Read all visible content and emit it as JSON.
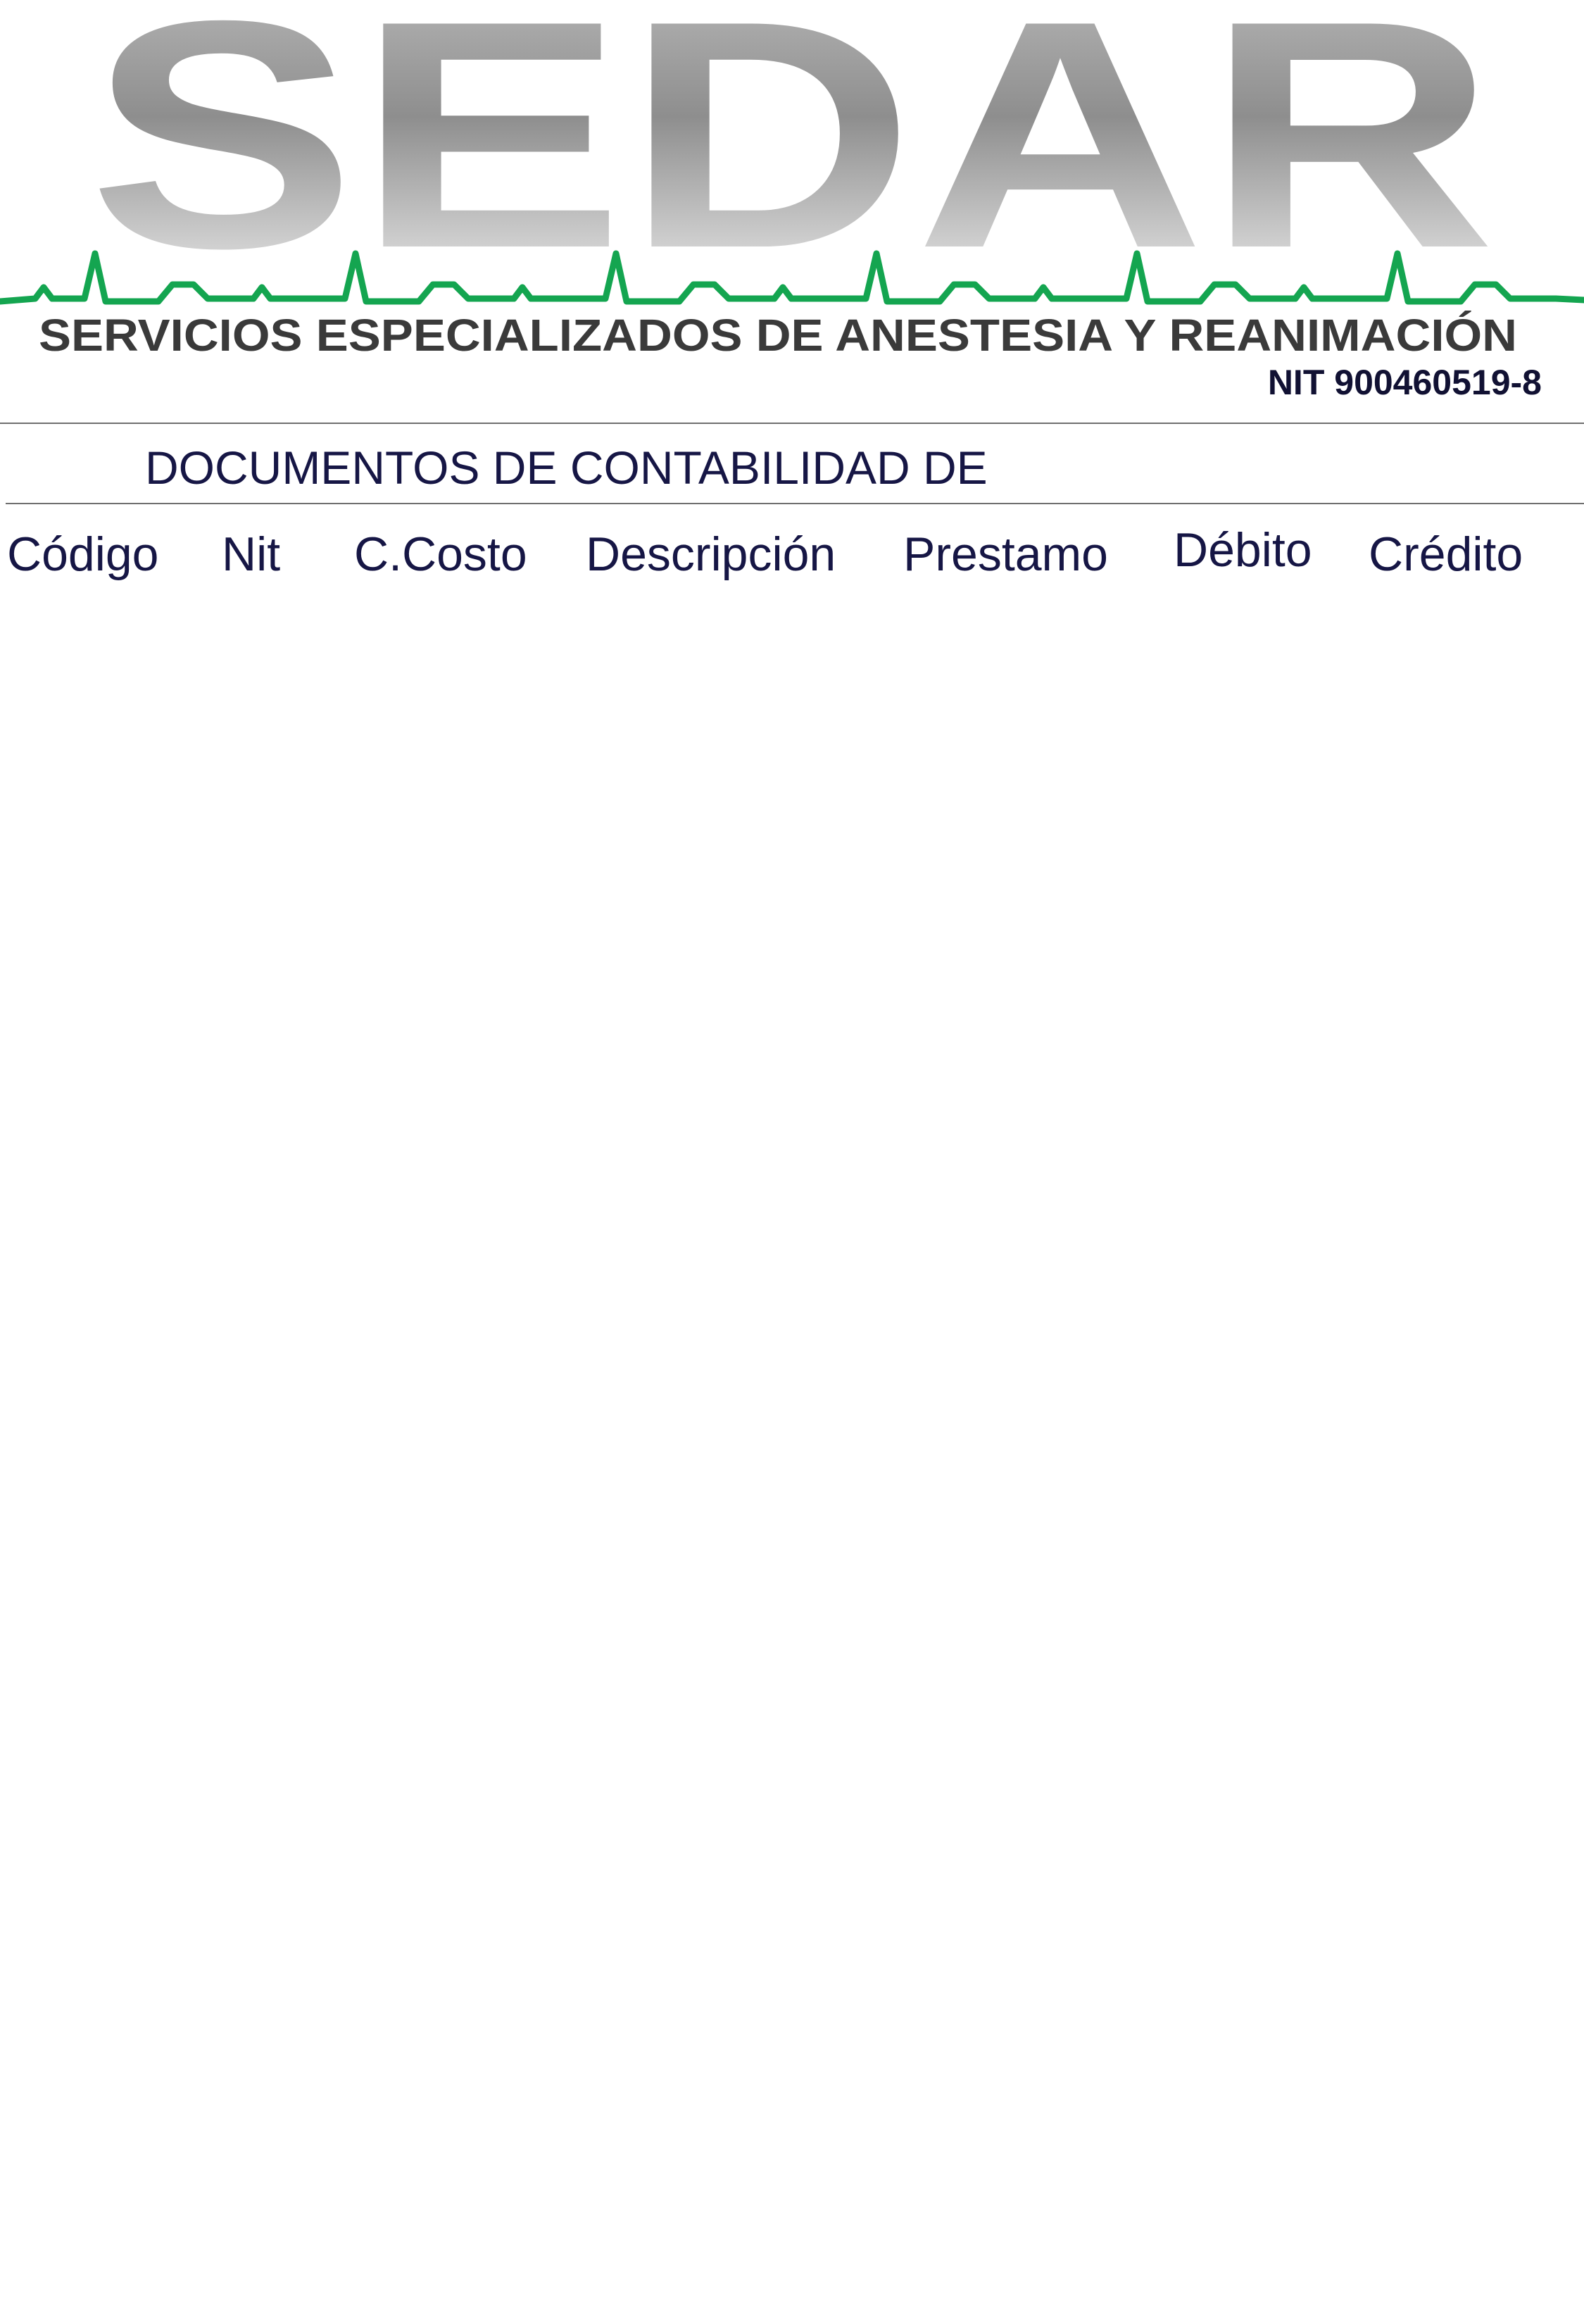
{
  "header": {
    "logo_text": "SEDAR",
    "company_name": "SERVICIOS ESPECIALIZADOS DE ANESTESIA Y REANIMACIÓN",
    "nit": "NIT 900460519-8"
  },
  "document": {
    "title": "DOCUMENTOS DE CONTABILIDAD DE"
  },
  "table": {
    "columns": [
      "Código",
      "Nit",
      "C.Costo",
      "Descripción",
      "Prestamo",
      "Débito",
      "Crédito"
    ]
  },
  "colors": {
    "logo_gray_light": "#d9d9d9",
    "logo_gray_dark": "#8a8a8a",
    "ecg_green": "#14a550",
    "company_text": "#3a3a3a",
    "body_text": "#161645"
  },
  "icons": {
    "logo": "sedar-logo",
    "ecg_line": "ecg-line-icon"
  }
}
